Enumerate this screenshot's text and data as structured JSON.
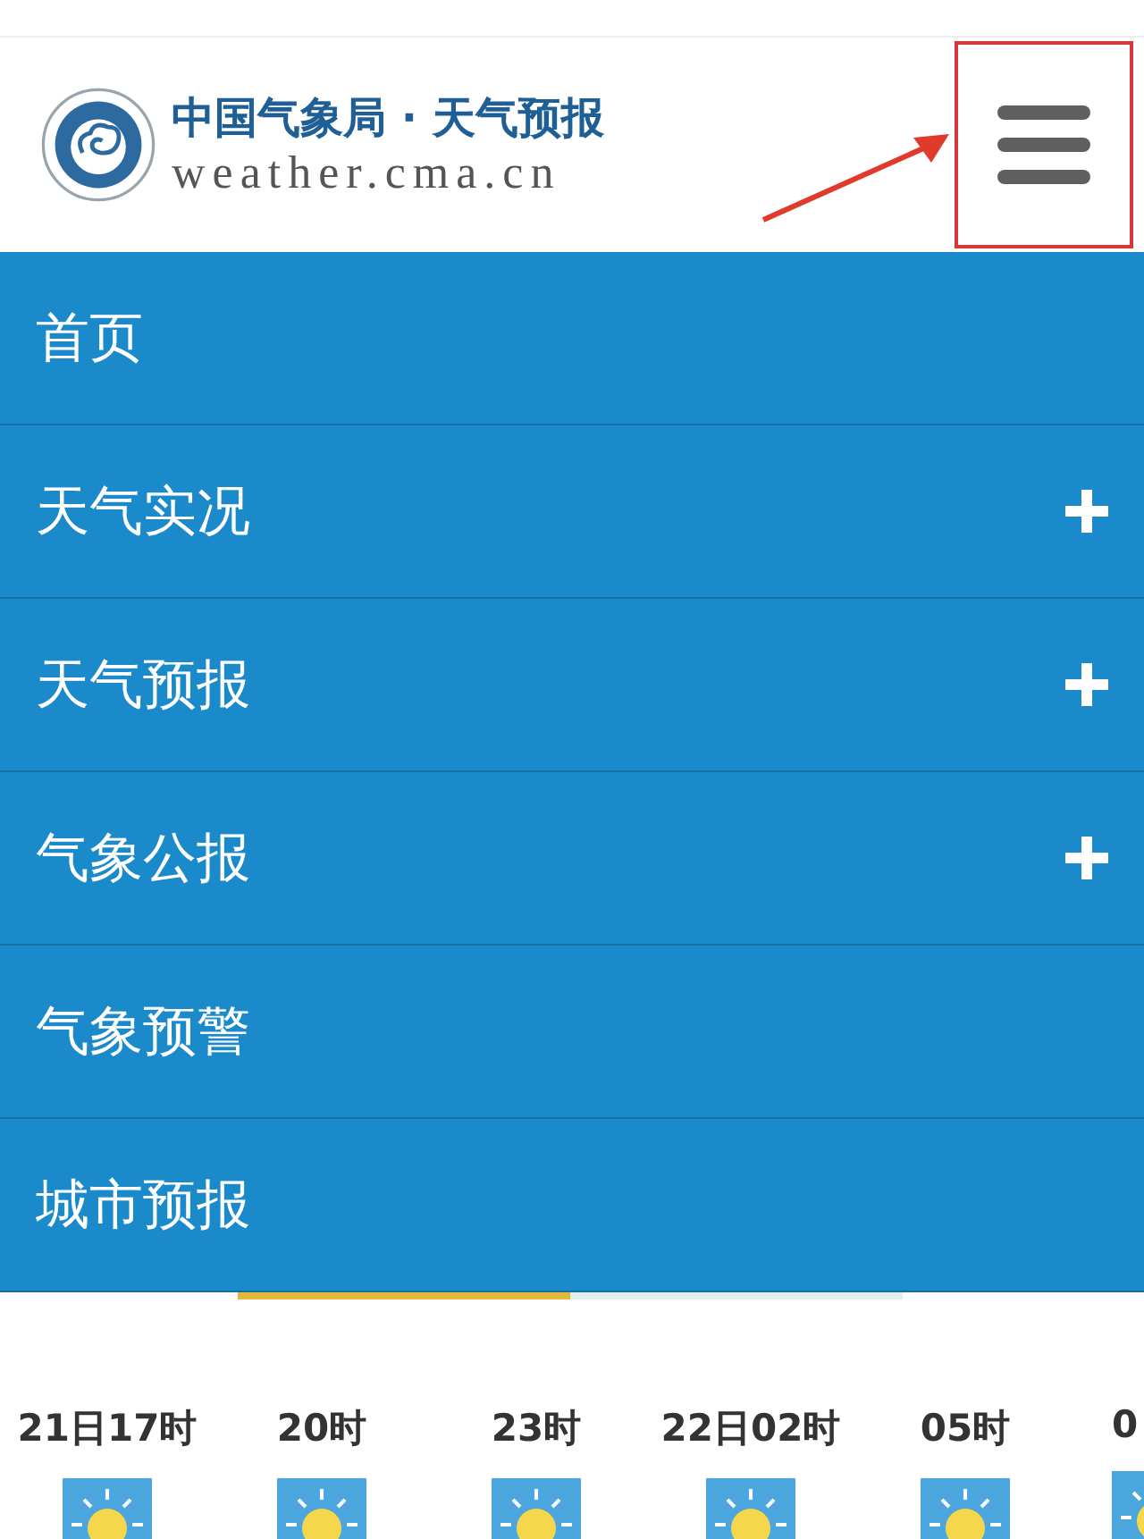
{
  "header": {
    "title": "中国气象局 · 天气预报",
    "subtitle": "weather.cma.cn",
    "menu_button": {
      "highlighted": true
    }
  },
  "menu": [
    {
      "label": "首页",
      "expandable": false
    },
    {
      "label": "天气实况",
      "expandable": true
    },
    {
      "label": "天气预报",
      "expandable": true
    },
    {
      "label": "气象公报",
      "expandable": true
    },
    {
      "label": "气象预警",
      "expandable": false
    },
    {
      "label": "城市预报",
      "expandable": false
    }
  ],
  "forecast_tabs": [
    {
      "selected": true
    },
    {
      "selected": false
    }
  ],
  "hours": [
    {
      "time": "21日17时",
      "kind": "sunny"
    },
    {
      "time": "20时",
      "kind": "sunny"
    },
    {
      "time": "23时",
      "kind": "sunny"
    },
    {
      "time": "22日02时",
      "kind": "sunny"
    },
    {
      "time": "05时",
      "kind": "sunny"
    },
    {
      "time": "0",
      "kind": "sunny"
    }
  ]
}
